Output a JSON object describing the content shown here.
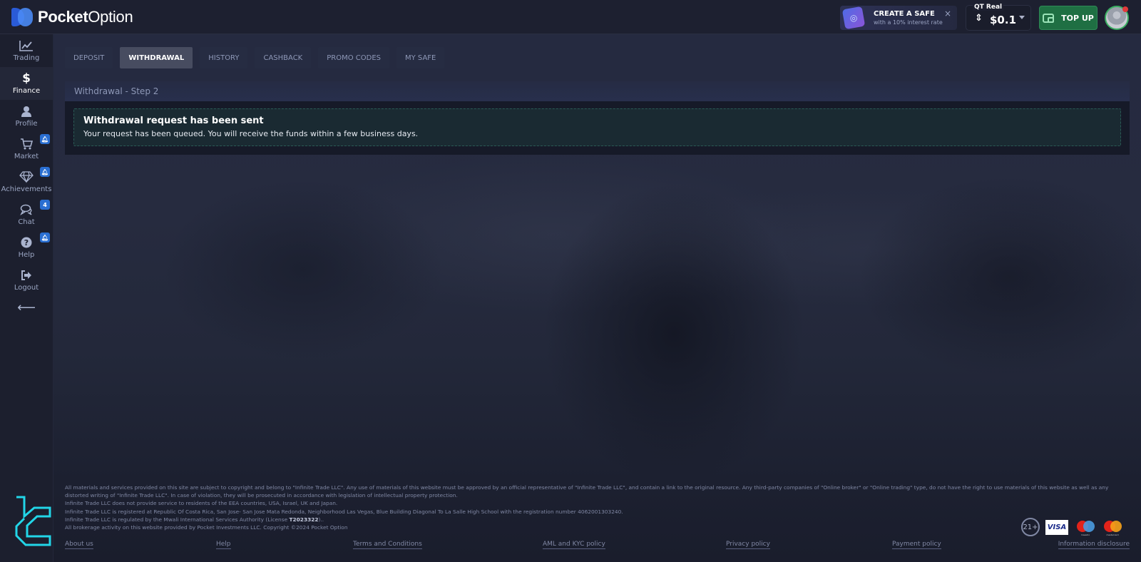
{
  "header": {
    "logo_bold": "Pocket",
    "logo_light": "Option",
    "promo": {
      "title": "CREATE A SAFE",
      "subtitle": "with a 10% interest rate",
      "close": "×"
    },
    "account": {
      "label": "QT Real",
      "balance": "$0.1"
    },
    "topup_label": "TOP UP"
  },
  "sidebar": {
    "items": [
      {
        "label": "Trading",
        "icon": "chart-line-icon",
        "glyph": "📈",
        "badge": null
      },
      {
        "label": "Finance",
        "icon": "dollar-icon",
        "glyph": "$",
        "badge": null,
        "active": true
      },
      {
        "label": "Profile",
        "icon": "user-icon",
        "glyph": "👤",
        "badge": null
      },
      {
        "label": "Market",
        "icon": "cart-icon",
        "glyph": "🛒",
        "badge": "🔔"
      },
      {
        "label": "Achievements",
        "icon": "diamond-icon",
        "glyph": "◇",
        "badge": "🔔"
      },
      {
        "label": "Chat",
        "icon": "chat-icon",
        "glyph": "💬",
        "badge": "4"
      },
      {
        "label": "Help",
        "icon": "question-icon",
        "glyph": "?",
        "badge": "🔔"
      },
      {
        "label": "Logout",
        "icon": "logout-icon",
        "glyph": "⇥",
        "badge": null
      }
    ],
    "collapse_glyph": "⟵"
  },
  "tabs": [
    {
      "label": "DEPOSIT",
      "active": false
    },
    {
      "label": "WITHDRAWAL",
      "active": true
    },
    {
      "label": "HISTORY",
      "active": false
    },
    {
      "label": "CASHBACK",
      "active": false
    },
    {
      "label": "PROMO CODES",
      "active": false
    },
    {
      "label": "MY SAFE",
      "active": false
    }
  ],
  "step_title": "Withdrawal - Step 2",
  "result": {
    "title": "Withdrawal request has been sent",
    "message": "Your request has been queued. You will receive the funds within a few business days."
  },
  "footer": {
    "legal": [
      "All materials and services provided on this site are subject to copyright and belong to \"Infinite Trade LLC\". Any use of materials of this website must be approved by an official representative of \"Infinite Trade LLC\", and contain a link to the original resource. Any third-party companies of \"Online broker\" or \"Online trading\" type, do not have the right to use materials of this website as well as any distorted writing of \"Infinite Trade LLC\". In case of violation, they will be prosecuted in accordance with legislation of intellectual property protection.",
      "Infinite Trade LLC does not provide service to residents of the EEA countries, USA, Israel, UK and Japan.",
      "Infinite Trade LLC is registered at Republic Of Costa Rica, San Jose- San Jose Mata Redonda, Neighborhood Las Vegas, Blue Building Diagonal To La Salle High School with the registration number 4062001303240."
    ],
    "regulated_prefix": "Infinite Trade LLC is regulated by the Mwali International Services Authority (License ",
    "license": "T2023322",
    "regulated_suffix": ")..",
    "copyright": "All brokerage activity on this website provided by Pocket Investments LLC. Copyright ©2024 Pocket Option",
    "links": [
      "About us",
      "Help",
      "Terms and Conditions",
      "AML and KYC policy",
      "Privacy policy",
      "Payment policy",
      "Information disclosure"
    ],
    "age_badge": "21+",
    "payment_badges": {
      "visa": "VISA",
      "maestro": "maestro",
      "mastercard": "mastercard"
    }
  }
}
